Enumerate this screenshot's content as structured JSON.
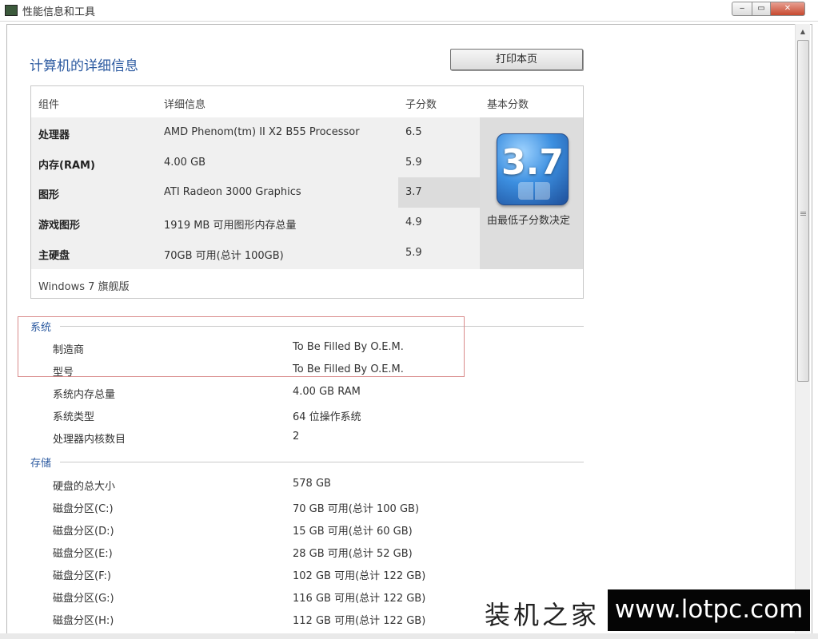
{
  "window": {
    "title": "性能信息和工具",
    "controls": {
      "minimize": "‒",
      "maximize": "▭",
      "close": "✕"
    }
  },
  "page": {
    "title": "计算机的详细信息",
    "print_button": "打印本页"
  },
  "score_table": {
    "headers": {
      "component": "组件",
      "details": "详细信息",
      "subscore": "子分数",
      "base_score": "基本分数"
    },
    "rows": [
      {
        "label": "处理器",
        "detail": "AMD Phenom(tm) II X2 B55 Processor",
        "subscore": "6.5"
      },
      {
        "label": "内存(RAM)",
        "detail": "4.00 GB",
        "subscore": "5.9"
      },
      {
        "label": "图形",
        "detail": "ATI Radeon 3000 Graphics",
        "subscore": "3.7"
      },
      {
        "label": "游戏图形",
        "detail": "1919 MB 可用图形内存总量",
        "subscore": "4.9"
      },
      {
        "label": "主硬盘",
        "detail": "70GB 可用(总计 100GB)",
        "subscore": "5.9"
      }
    ],
    "base_score": "3.7",
    "base_caption": "由最低子分数决定",
    "edition": "Windows 7 旗舰版"
  },
  "system": {
    "heading": "系统",
    "items": [
      {
        "label": "制造商",
        "value": "To Be Filled By O.E.M."
      },
      {
        "label": "型号",
        "value": "To Be Filled By O.E.M."
      },
      {
        "label": "系统内存总量",
        "value": "4.00 GB RAM"
      },
      {
        "label": "系统类型",
        "value": "64 位操作系统"
      },
      {
        "label": "处理器内核数目",
        "value": "2"
      }
    ]
  },
  "storage": {
    "heading": "存储",
    "items": [
      {
        "label": "硬盘的总大小",
        "value": "578 GB"
      },
      {
        "label": "磁盘分区(C:)",
        "value": "70 GB 可用(总计 100 GB)"
      },
      {
        "label": "磁盘分区(D:)",
        "value": "15 GB 可用(总计 60 GB)"
      },
      {
        "label": "磁盘分区(E:)",
        "value": "28 GB 可用(总计 52 GB)"
      },
      {
        "label": "磁盘分区(F:)",
        "value": "102 GB 可用(总计 122 GB)"
      },
      {
        "label": "磁盘分区(G:)",
        "value": "116 GB 可用(总计 122 GB)"
      },
      {
        "label": "磁盘分区(H:)",
        "value": "112 GB 可用(总计 122 GB)"
      }
    ]
  },
  "watermark": {
    "cn": "装机之家",
    "url": "www.lotpc.com"
  },
  "scrollbar": {
    "up_arrow": "▲"
  },
  "colors": {
    "heading_blue": "#2c5aa0",
    "highlight_red": "#d98b8b",
    "badge_blue": "#3c8fe0"
  }
}
